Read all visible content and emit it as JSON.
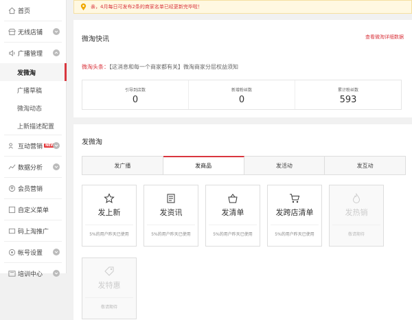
{
  "sidebar": {
    "items": [
      {
        "label": "首页",
        "icon": "home-icon"
      },
      {
        "label": "无线店铺",
        "icon": "store-icon"
      },
      {
        "label": "广播管理",
        "icon": "broadcast-icon"
      },
      {
        "label": "互动营销",
        "icon": "interaction-icon",
        "badge": "NEW"
      },
      {
        "label": "数据分析",
        "icon": "analytics-icon"
      },
      {
        "label": "会员营销",
        "icon": "member-icon"
      },
      {
        "label": "自定义菜单",
        "icon": "menu-icon"
      },
      {
        "label": "码上淘推广",
        "icon": "qrcode-icon"
      },
      {
        "label": "帐号设置",
        "icon": "settings-icon"
      },
      {
        "label": "培训中心",
        "icon": "training-icon"
      }
    ],
    "sub_items": [
      "发微淘",
      "广播草稿",
      "微淘动态",
      "上新描述配置"
    ]
  },
  "notice": {
    "text": "亲，4月每日可发布2条的商家名单已经更新完毕啦！"
  },
  "news": {
    "title": "微淘快讯",
    "more_link": "查看微淘详细数据",
    "headline_prefix": "微淘头条：",
    "headline_text": "【这消息和每一个商家都有关】微淘商家分层权益须知",
    "stats": [
      {
        "label": "引导到店数",
        "value": "0"
      },
      {
        "label": "新增粉丝数",
        "value": "0"
      },
      {
        "label": "累计粉丝数",
        "value": "593"
      }
    ]
  },
  "publish": {
    "title": "发微淘",
    "tabs": [
      "发广播",
      "发商品",
      "发活动",
      "发互动"
    ],
    "active_tab": "发商品",
    "cards": [
      {
        "name": "发上新",
        "desc": "5%的用户昨天已使用",
        "icon": "star-icon",
        "enabled": true
      },
      {
        "name": "发资讯",
        "desc": "5%的用户昨天已使用",
        "icon": "news-icon",
        "enabled": true
      },
      {
        "name": "发清单",
        "desc": "5%的用户昨天已使用",
        "icon": "basket-icon",
        "enabled": true
      },
      {
        "name": "发跨店清单",
        "desc": "5%的用户昨天已使用",
        "icon": "cart-icon",
        "enabled": true
      },
      {
        "name": "发热销",
        "desc": "敬请期待",
        "icon": "flame-icon",
        "enabled": false
      },
      {
        "name": "发特惠",
        "desc": "敬请期待",
        "icon": "tag-icon",
        "enabled": false
      }
    ]
  },
  "colors": {
    "accent": "#d9363e",
    "notice_bg": "#fff8e1",
    "pin": "#f0a800"
  }
}
